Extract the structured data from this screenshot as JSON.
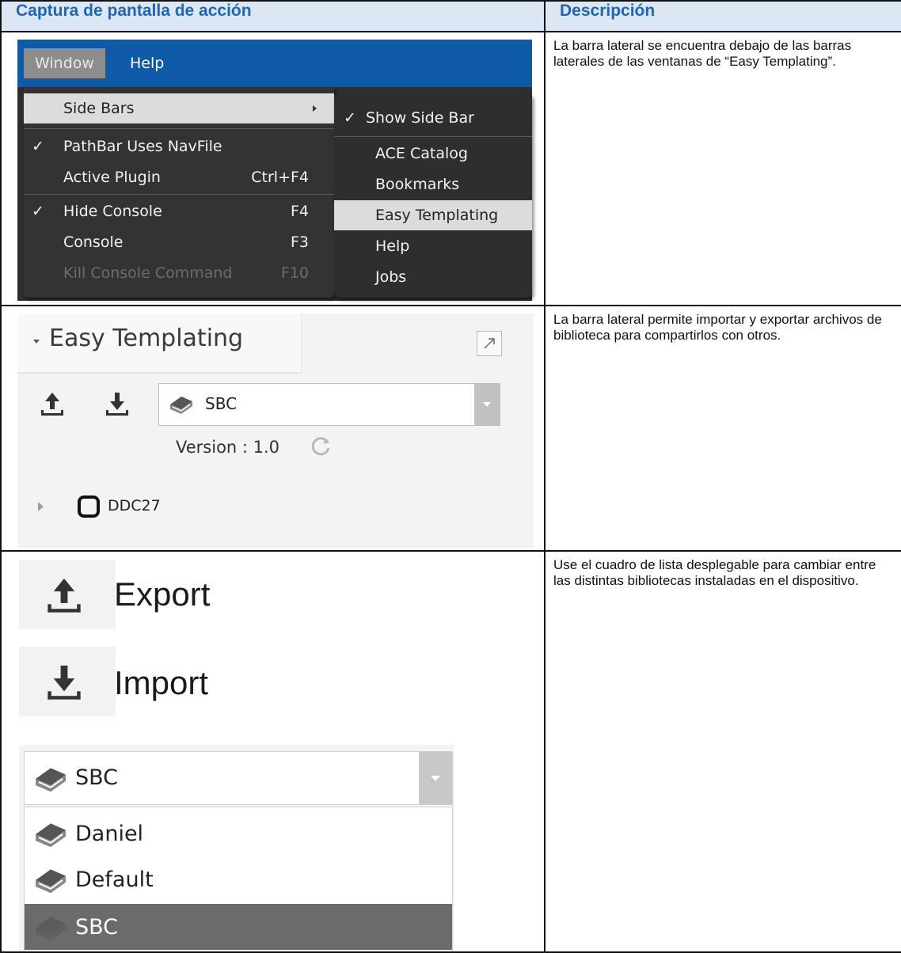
{
  "header": {
    "col1": "Captura de pantalla de acción",
    "col2": "Descripción"
  },
  "rows": [
    {
      "description": "La barra lateral se encuentra debajo de las barras laterales de las ventanas de “Easy Templating”."
    },
    {
      "description": "La barra lateral permite importar y exportar archivos de biblioteca para compartirlos con otros."
    },
    {
      "description": "Use el cuadro de lista desplegable para cambiar entre las distintas bibliotecas instaladas en el dispositivo."
    }
  ],
  "menu_screenshot": {
    "menubar": [
      "Window",
      "Help"
    ],
    "window_menu": [
      {
        "label": "Side Bars",
        "checked": false,
        "shortcut": "",
        "submenu": true,
        "highlighted": true
      },
      {
        "label": "PathBar Uses NavFile",
        "checked": true,
        "shortcut": ""
      },
      {
        "label": "Active Plugin",
        "checked": false,
        "shortcut": "Ctrl+F4"
      },
      {
        "label": "Hide Console",
        "checked": true,
        "shortcut": "F4"
      },
      {
        "label": "Console",
        "checked": false,
        "shortcut": "F3"
      },
      {
        "label": "Kill Console Command",
        "checked": false,
        "shortcut": "F10",
        "disabled": true
      }
    ],
    "checkmark": "✓",
    "sidebars_submenu": [
      {
        "label": "Show Side Bar",
        "checked": true
      },
      {
        "label": "ACE Catalog"
      },
      {
        "label": "Bookmarks"
      },
      {
        "label": "Easy Templating",
        "highlighted": true
      },
      {
        "label": "Help"
      },
      {
        "label": "Jobs"
      }
    ]
  },
  "sidebar_screenshot": {
    "title": "Easy Templating",
    "library": "SBC",
    "version": "Version : 1.0",
    "tree_node": "DDC27",
    "icons": [
      "export-icon",
      "import-icon",
      "library-book-icon",
      "refresh-icon",
      "expand-icon",
      "station-icon"
    ]
  },
  "dropdown_screenshot": {
    "export_label": "Export",
    "import_label": "Import",
    "selected": "SBC",
    "options": [
      "Daniel",
      "Default",
      "SBC"
    ],
    "selected_option": "SBC"
  },
  "colors": {
    "header_bg": "#dbe7f4",
    "header_text": "#1f66b5",
    "menubar": "#0e5aa7",
    "menu_bg": "#333333",
    "highlight": "#dcdcdc",
    "dropdown_selected": "#6b6b6e"
  }
}
